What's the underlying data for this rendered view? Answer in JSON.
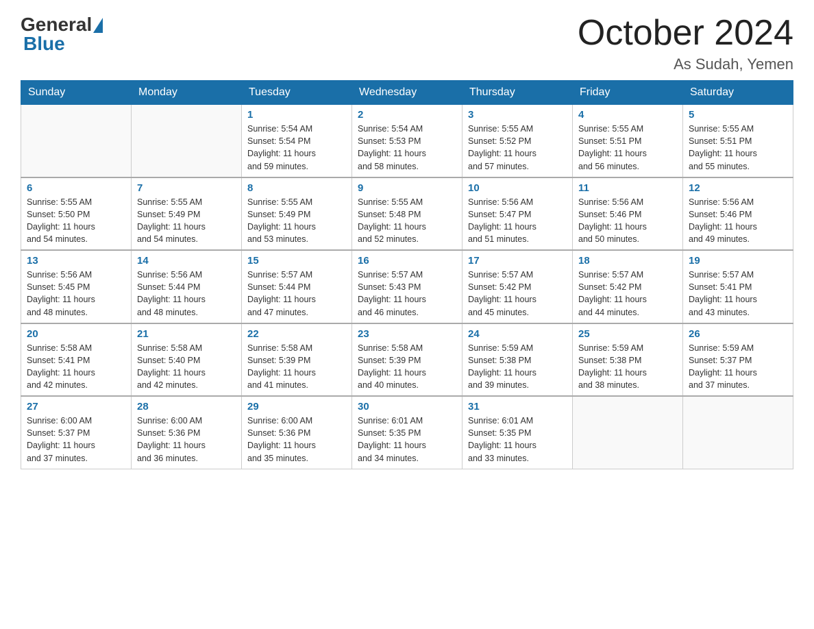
{
  "header": {
    "logo_general": "General",
    "logo_blue": "Blue",
    "month": "October 2024",
    "location": "As Sudah, Yemen"
  },
  "weekdays": [
    "Sunday",
    "Monday",
    "Tuesday",
    "Wednesday",
    "Thursday",
    "Friday",
    "Saturday"
  ],
  "weeks": [
    [
      {
        "day": "",
        "info": ""
      },
      {
        "day": "",
        "info": ""
      },
      {
        "day": "1",
        "info": "Sunrise: 5:54 AM\nSunset: 5:54 PM\nDaylight: 11 hours\nand 59 minutes."
      },
      {
        "day": "2",
        "info": "Sunrise: 5:54 AM\nSunset: 5:53 PM\nDaylight: 11 hours\nand 58 minutes."
      },
      {
        "day": "3",
        "info": "Sunrise: 5:55 AM\nSunset: 5:52 PM\nDaylight: 11 hours\nand 57 minutes."
      },
      {
        "day": "4",
        "info": "Sunrise: 5:55 AM\nSunset: 5:51 PM\nDaylight: 11 hours\nand 56 minutes."
      },
      {
        "day": "5",
        "info": "Sunrise: 5:55 AM\nSunset: 5:51 PM\nDaylight: 11 hours\nand 55 minutes."
      }
    ],
    [
      {
        "day": "6",
        "info": "Sunrise: 5:55 AM\nSunset: 5:50 PM\nDaylight: 11 hours\nand 54 minutes."
      },
      {
        "day": "7",
        "info": "Sunrise: 5:55 AM\nSunset: 5:49 PM\nDaylight: 11 hours\nand 54 minutes."
      },
      {
        "day": "8",
        "info": "Sunrise: 5:55 AM\nSunset: 5:49 PM\nDaylight: 11 hours\nand 53 minutes."
      },
      {
        "day": "9",
        "info": "Sunrise: 5:55 AM\nSunset: 5:48 PM\nDaylight: 11 hours\nand 52 minutes."
      },
      {
        "day": "10",
        "info": "Sunrise: 5:56 AM\nSunset: 5:47 PM\nDaylight: 11 hours\nand 51 minutes."
      },
      {
        "day": "11",
        "info": "Sunrise: 5:56 AM\nSunset: 5:46 PM\nDaylight: 11 hours\nand 50 minutes."
      },
      {
        "day": "12",
        "info": "Sunrise: 5:56 AM\nSunset: 5:46 PM\nDaylight: 11 hours\nand 49 minutes."
      }
    ],
    [
      {
        "day": "13",
        "info": "Sunrise: 5:56 AM\nSunset: 5:45 PM\nDaylight: 11 hours\nand 48 minutes."
      },
      {
        "day": "14",
        "info": "Sunrise: 5:56 AM\nSunset: 5:44 PM\nDaylight: 11 hours\nand 48 minutes."
      },
      {
        "day": "15",
        "info": "Sunrise: 5:57 AM\nSunset: 5:44 PM\nDaylight: 11 hours\nand 47 minutes."
      },
      {
        "day": "16",
        "info": "Sunrise: 5:57 AM\nSunset: 5:43 PM\nDaylight: 11 hours\nand 46 minutes."
      },
      {
        "day": "17",
        "info": "Sunrise: 5:57 AM\nSunset: 5:42 PM\nDaylight: 11 hours\nand 45 minutes."
      },
      {
        "day": "18",
        "info": "Sunrise: 5:57 AM\nSunset: 5:42 PM\nDaylight: 11 hours\nand 44 minutes."
      },
      {
        "day": "19",
        "info": "Sunrise: 5:57 AM\nSunset: 5:41 PM\nDaylight: 11 hours\nand 43 minutes."
      }
    ],
    [
      {
        "day": "20",
        "info": "Sunrise: 5:58 AM\nSunset: 5:41 PM\nDaylight: 11 hours\nand 42 minutes."
      },
      {
        "day": "21",
        "info": "Sunrise: 5:58 AM\nSunset: 5:40 PM\nDaylight: 11 hours\nand 42 minutes."
      },
      {
        "day": "22",
        "info": "Sunrise: 5:58 AM\nSunset: 5:39 PM\nDaylight: 11 hours\nand 41 minutes."
      },
      {
        "day": "23",
        "info": "Sunrise: 5:58 AM\nSunset: 5:39 PM\nDaylight: 11 hours\nand 40 minutes."
      },
      {
        "day": "24",
        "info": "Sunrise: 5:59 AM\nSunset: 5:38 PM\nDaylight: 11 hours\nand 39 minutes."
      },
      {
        "day": "25",
        "info": "Sunrise: 5:59 AM\nSunset: 5:38 PM\nDaylight: 11 hours\nand 38 minutes."
      },
      {
        "day": "26",
        "info": "Sunrise: 5:59 AM\nSunset: 5:37 PM\nDaylight: 11 hours\nand 37 minutes."
      }
    ],
    [
      {
        "day": "27",
        "info": "Sunrise: 6:00 AM\nSunset: 5:37 PM\nDaylight: 11 hours\nand 37 minutes."
      },
      {
        "day": "28",
        "info": "Sunrise: 6:00 AM\nSunset: 5:36 PM\nDaylight: 11 hours\nand 36 minutes."
      },
      {
        "day": "29",
        "info": "Sunrise: 6:00 AM\nSunset: 5:36 PM\nDaylight: 11 hours\nand 35 minutes."
      },
      {
        "day": "30",
        "info": "Sunrise: 6:01 AM\nSunset: 5:35 PM\nDaylight: 11 hours\nand 34 minutes."
      },
      {
        "day": "31",
        "info": "Sunrise: 6:01 AM\nSunset: 5:35 PM\nDaylight: 11 hours\nand 33 minutes."
      },
      {
        "day": "",
        "info": ""
      },
      {
        "day": "",
        "info": ""
      }
    ]
  ]
}
